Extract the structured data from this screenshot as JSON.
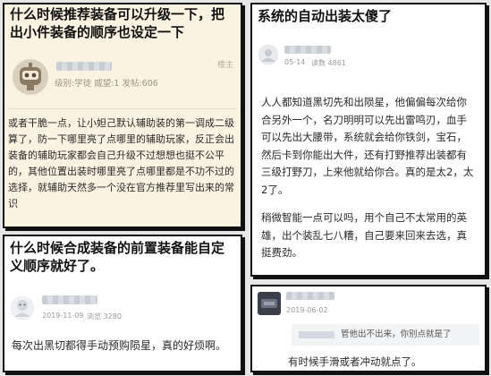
{
  "card_a": {
    "title": "什么时候推荐装备可以升级一下，把出小件装备的顺序也设定一下",
    "meta_text": "级别:学徒  威望:1  发帖:606",
    "floor_label": "楼主",
    "body": "或者干脆一点，让小妲己默认辅助装的第一调成二级算了，防一下哪里亮了点哪里的辅助玩家，反正会出装备的辅助玩家都会自己升级不过想想也挺不公平的，其他位置出装时哪里亮了点哪里都是不功不过的选择，就辅助天然多一个没在官方推荐里写出来的常识"
  },
  "card_b": {
    "title": "系统的自动出装太傻了",
    "date": "05-14",
    "reads": "读数 4861",
    "paragraph1": "人人都知道黑切先和出陨星，他偏偏每次给你合另外一个，名刀明明可以先出雷鸣刃，血手可以先出大腰带，系统就会给你铁剑，宝石，然后卡到你能出大件，还有打野推荐出装都有三级打野刀，上来他就给你合。真的是太2，太2了。",
    "paragraph2": "稍微智能一点可以吗，用个自己不太常用的英雄，出个装乱七八糟，自己要来回来去选，真挺费劲。"
  },
  "card_c": {
    "title": "什么时候合成装备的前置装备能自定义顺序就好了。",
    "date": "2019-11-09",
    "reads": "浏览 3280",
    "body": "每次出黑切都得手动预购陨星，真的好烦啊。"
  },
  "card_d": {
    "date": "2019-06-02",
    "quote": "管他出不出来，你别点就是了",
    "body": "有时候手滑或者冲动就点了。"
  }
}
